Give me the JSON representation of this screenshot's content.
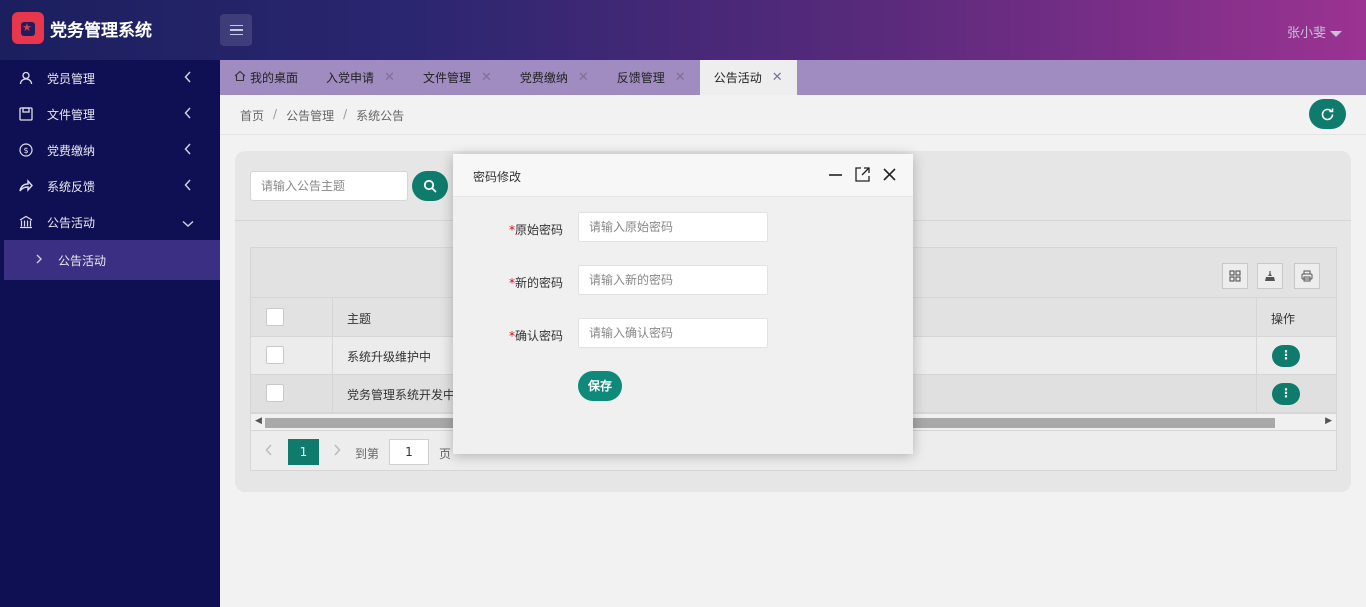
{
  "app": {
    "title": "党务管理系统"
  },
  "header": {
    "user_name": "张小斐"
  },
  "sidebar": {
    "items": [
      {
        "label": "党员管理",
        "icon": "user-icon"
      },
      {
        "label": "文件管理",
        "icon": "save-icon"
      },
      {
        "label": "党费缴纳",
        "icon": "dollar-icon"
      },
      {
        "label": "系统反馈",
        "icon": "share-icon"
      },
      {
        "label": "公告活动",
        "icon": "bank-icon"
      }
    ],
    "sub_items": [
      {
        "label": "公告活动"
      }
    ]
  },
  "tabs": [
    {
      "label": "我的桌面"
    },
    {
      "label": "入党申请"
    },
    {
      "label": "文件管理"
    },
    {
      "label": "党费缴纳"
    },
    {
      "label": "反馈管理"
    },
    {
      "label": "公告活动",
      "active": true
    }
  ],
  "breadcrumb": [
    "首页",
    "公告管理",
    "系统公告"
  ],
  "search": {
    "placeholder": "请输入公告主题"
  },
  "table": {
    "columns": [
      "主题",
      "操作"
    ],
    "rows": [
      {
        "title": "系统升级维护中",
        "op": "⋮"
      },
      {
        "title": "党务管理系统开发中",
        "op": "⋮"
      }
    ]
  },
  "pager": {
    "current_page": "1",
    "goto_label": "到第",
    "goto_value": "1",
    "page_suffix": "页"
  },
  "modal": {
    "title": "密码修改",
    "fields": [
      {
        "label": "原始密码",
        "placeholder": "请输入原始密码"
      },
      {
        "label": "新的密码",
        "placeholder": "请输入新的密码"
      },
      {
        "label": "确认密码",
        "placeholder": "请输入确认密码"
      }
    ],
    "required_mark": "*",
    "save_label": "保存"
  },
  "colors": {
    "accent": "#0f7b6c",
    "sidebar": "#0f1054",
    "active_sub": "#3a2f82"
  }
}
